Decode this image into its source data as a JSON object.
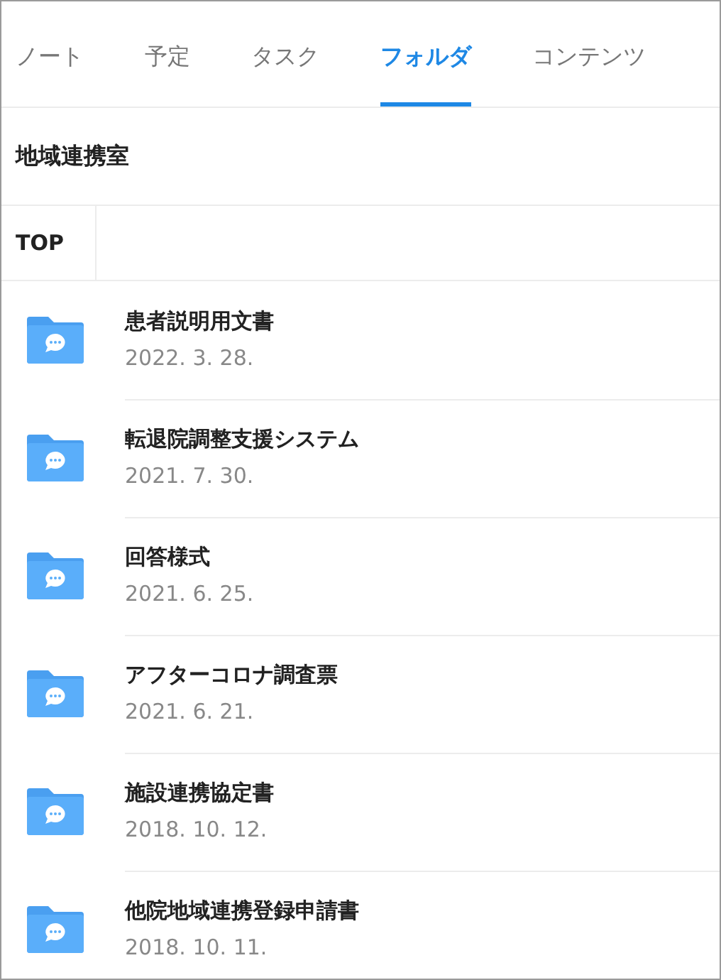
{
  "tabs": [
    {
      "label": "ノート",
      "selected": false
    },
    {
      "label": "予定",
      "selected": false
    },
    {
      "label": "タスク",
      "selected": false
    },
    {
      "label": "フォルダ",
      "selected": true
    },
    {
      "label": "コンテンツ",
      "selected": false
    }
  ],
  "folder_title": "地域連携室",
  "breadcrumb": [
    "TOP"
  ],
  "folders": [
    {
      "name": "患者説明用文書",
      "date": "2022. 3. 28."
    },
    {
      "name": "転退院調整支援システム",
      "date": "2021. 7. 30."
    },
    {
      "name": "回答様式",
      "date": "2021. 6. 25."
    },
    {
      "name": "アフターコロナ調査票",
      "date": "2021. 6. 21."
    },
    {
      "name": "施設連携協定書",
      "date": "2018. 10. 12."
    },
    {
      "name": "他院地域連携登録申請書",
      "date": "2018. 10. 11."
    }
  ]
}
